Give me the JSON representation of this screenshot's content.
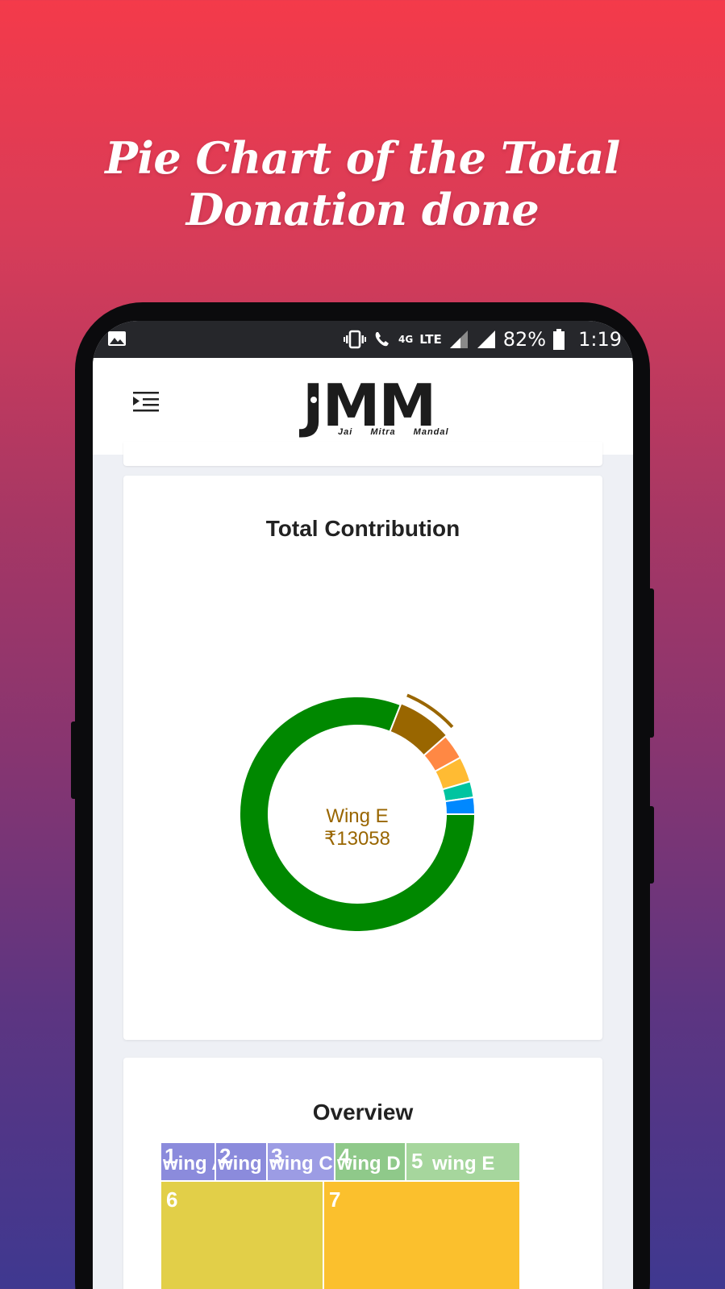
{
  "headline": "Pie Chart of the Total Donation done",
  "statusbar": {
    "network_small": "4G",
    "network": "LTE",
    "battery": "82%",
    "time": "1:19"
  },
  "app": {
    "logo_text": "JMM",
    "logo_subtitle": "Jai Mitra Mandal"
  },
  "contribution_card": {
    "title": "Total Contribution",
    "center_label": "Wing E",
    "center_value": "₹13058"
  },
  "overview_card": {
    "title": "Overview"
  },
  "colors": {
    "green": "#008800",
    "brown": "#996600",
    "orange": "#ff8844",
    "yellow": "#ffbb33",
    "teal": "#00c4a0",
    "blue": "#0088ff",
    "center_text": "#996600"
  },
  "chart_data": [
    {
      "type": "pie",
      "title": "Total Contribution",
      "slices": [
        {
          "color": "#008800",
          "value": 0.81
        },
        {
          "color": "#996600",
          "value": 0.075,
          "highlighted": true
        },
        {
          "color": "#ff8844",
          "value": 0.035
        },
        {
          "color": "#ffbb33",
          "value": 0.035
        },
        {
          "color": "#00c4a0",
          "value": 0.022
        },
        {
          "color": "#0088ff",
          "value": 0.023
        }
      ],
      "highlighted_label": "Wing E",
      "highlighted_value": "₹13058",
      "donut": true
    },
    {
      "type": "treemap",
      "title": "Overview",
      "cells": [
        {
          "num": "1",
          "label": "wing A",
          "color": "#8b8bdc"
        },
        {
          "num": "2",
          "label": "wing B",
          "color": "#8b8bdc"
        },
        {
          "num": "3",
          "label": "wing C",
          "color": "#9c9ce4"
        },
        {
          "num": "4",
          "label": "wing D",
          "color": "#8fc98a"
        },
        {
          "num": "5",
          "label": "wing E",
          "color": "#a6d69d"
        },
        {
          "num": "6",
          "label": "",
          "color": "#e2cf48"
        },
        {
          "num": "7",
          "label": "",
          "color": "#fbc02d"
        }
      ]
    }
  ]
}
